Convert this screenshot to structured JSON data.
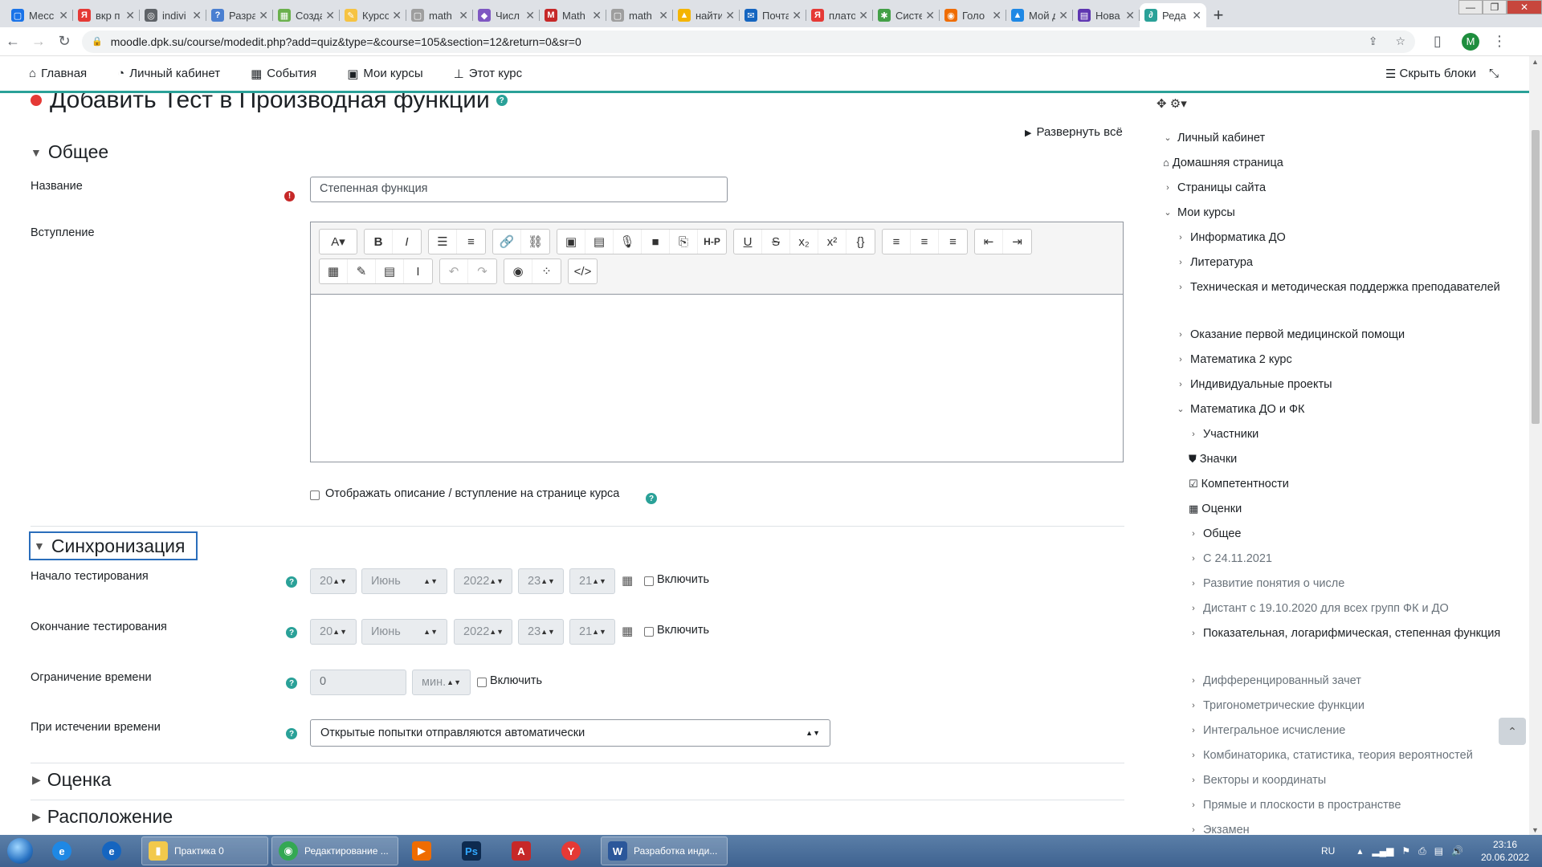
{
  "browser": {
    "tabs": [
      {
        "title": "Месс",
        "color": "#1a73e8",
        "glyph": "▢"
      },
      {
        "title": "вкр п",
        "color": "#e53935",
        "glyph": "Я"
      },
      {
        "title": "indivi",
        "color": "#5f6368",
        "glyph": "◎"
      },
      {
        "title": "Разра",
        "color": "#4a7fd1",
        "glyph": "?"
      },
      {
        "title": "Созда",
        "color": "#6ab04c",
        "glyph": "▦"
      },
      {
        "title": "Курсо",
        "color": "#f6c342",
        "glyph": "✎"
      },
      {
        "title": "math",
        "color": "#9e9e9e",
        "glyph": "▢"
      },
      {
        "title": "Числ",
        "color": "#7e57c2",
        "glyph": "◆"
      },
      {
        "title": "Math",
        "color": "#c62828",
        "glyph": "M"
      },
      {
        "title": "math",
        "color": "#9e9e9e",
        "glyph": "▢"
      },
      {
        "title": "найти",
        "color": "#f4b400",
        "glyph": "▲"
      },
      {
        "title": "Почта",
        "color": "#1565c0",
        "glyph": "✉"
      },
      {
        "title": "плато",
        "color": "#e53935",
        "glyph": "Я"
      },
      {
        "title": "Систе",
        "color": "#43a047",
        "glyph": "✱"
      },
      {
        "title": "Голо",
        "color": "#ef6c00",
        "glyph": "◉"
      },
      {
        "title": "Мой д",
        "color": "#1e88e5",
        "glyph": "▲"
      },
      {
        "title": "Нова",
        "color": "#5e35b1",
        "glyph": "▤"
      },
      {
        "title": "Реда",
        "color": "#2aa198",
        "glyph": "∂",
        "active": true
      }
    ],
    "url": "moodle.dpk.su/course/modedit.php?add=quiz&type=&course=105&section=12&return=0&sr=0",
    "profile_initial": "M"
  },
  "moodle_nav": {
    "home": "Главная",
    "dashboard": "Личный кабинет",
    "events": "События",
    "my_courses": "Мои курсы",
    "this_course": "Этот курс",
    "hide_blocks": "Скрыть блоки"
  },
  "page": {
    "title": "Добавить Тест в Производная функции",
    "expand_all": "Развернуть всё",
    "section_general": "Общее",
    "name_label": "Название",
    "name_value": "Степенная функция",
    "intro_label": "Вступление",
    "show_description_label": "Отображать описание / вступление на странице курса",
    "section_timing": "Синхронизация",
    "open_label": "Начало тестирования",
    "close_label": "Окончание тестирования",
    "date": {
      "day": "20",
      "month": "Июнь",
      "year": "2022",
      "hour": "23",
      "minute": "21"
    },
    "enable_label": "Включить",
    "time_limit_label": "Ограничение времени",
    "time_limit_value": "0",
    "time_limit_unit": "мин.",
    "overdue_label": "При истечении времени",
    "overdue_value": "Открытые попытки отправляются автоматически",
    "section_grade": "Оценка",
    "section_layout": "Расположение"
  },
  "block_nav": {
    "items": [
      {
        "label": "Личный кабинет",
        "level": 0,
        "kind": "open"
      },
      {
        "label": "Домашняя страница",
        "level": 0,
        "kind": "home"
      },
      {
        "label": "Страницы сайта",
        "level": 0,
        "kind": "closed"
      },
      {
        "label": "Мои курсы",
        "level": 0,
        "kind": "open"
      },
      {
        "label": "Информатика ДО",
        "level": 1,
        "kind": "closed"
      },
      {
        "label": "Литература",
        "level": 1,
        "kind": "closed"
      },
      {
        "label": "Техническая и методическая поддержка преподавателей",
        "level": 1,
        "kind": "closed",
        "wrap": true
      },
      {
        "label": "Оказание первой медицинской помощи",
        "level": 1,
        "kind": "closed"
      },
      {
        "label": "Математика 2 курс",
        "level": 1,
        "kind": "closed"
      },
      {
        "label": "Индивидуальные проекты",
        "level": 1,
        "kind": "closed"
      },
      {
        "label": "Математика ДО и ФК",
        "level": 1,
        "kind": "open"
      },
      {
        "label": "Участники",
        "level": 2,
        "kind": "closed"
      },
      {
        "label": "Значки",
        "level": 2,
        "kind": "badge"
      },
      {
        "label": "Компетентности",
        "level": 2,
        "kind": "check"
      },
      {
        "label": "Оценки",
        "level": 2,
        "kind": "grid"
      },
      {
        "label": "Общее",
        "level": 2,
        "kind": "closed"
      },
      {
        "label": "С 24.11.2021",
        "level": 2,
        "kind": "closed",
        "dim": true
      },
      {
        "label": "Развитие понятия о числе",
        "level": 2,
        "kind": "closed",
        "dim": true
      },
      {
        "label": "Дистант с 19.10.2020 для всех групп ФК и ДО",
        "level": 2,
        "kind": "closed",
        "dim": true
      },
      {
        "label": "Показательная, логарифмическая, степенная функция",
        "level": 2,
        "kind": "closed",
        "wrap": true
      },
      {
        "label": "Дифференцированный зачет",
        "level": 2,
        "kind": "closed",
        "dim": true
      },
      {
        "label": "Тригонометрические функции",
        "level": 2,
        "kind": "closed",
        "dim": true
      },
      {
        "label": "Интегральное исчисление",
        "level": 2,
        "kind": "closed",
        "dim": true
      },
      {
        "label": "Комбинаторика, статистика, теория вероятностей",
        "level": 2,
        "kind": "closed",
        "dim": true
      },
      {
        "label": "Векторы и координаты",
        "level": 2,
        "kind": "closed",
        "dim": true
      },
      {
        "label": "Прямые и плоскости в пространстве",
        "level": 2,
        "kind": "closed",
        "dim": true
      },
      {
        "label": "Экзамен",
        "level": 2,
        "kind": "closed",
        "dim": true
      }
    ]
  },
  "taskbar": {
    "items": [
      {
        "label": "Практика 0",
        "color": "#f2c94c",
        "glyph": "▮"
      },
      {
        "label": "Редактирование ...",
        "color": "#34a853",
        "glyph": "◉"
      },
      {
        "label": "Разработка инди...",
        "color": "#2b579a",
        "glyph": "W"
      }
    ],
    "lang": "RU",
    "time": "23:16",
    "date": "20.06.2022"
  }
}
